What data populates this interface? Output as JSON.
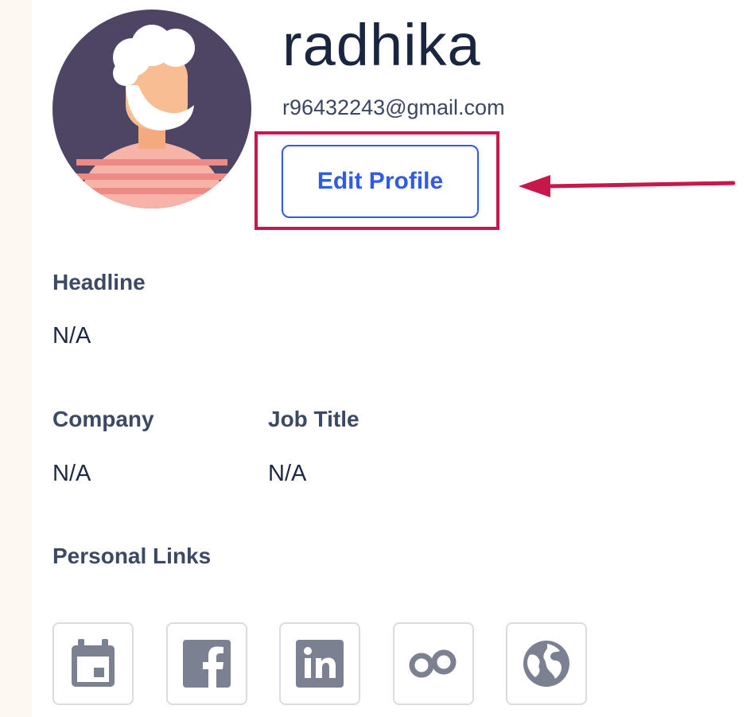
{
  "profile": {
    "name": "radhika",
    "email": "r96432243@gmail.com",
    "edit_button_label": "Edit Profile"
  },
  "fields": {
    "headline_label": "Headline",
    "headline_value": "N/A",
    "company_label": "Company",
    "company_value": "N/A",
    "job_title_label": "Job Title",
    "job_title_value": "N/A",
    "personal_links_label": "Personal Links"
  },
  "personal_links": [
    {
      "icon": "calendar-icon"
    },
    {
      "icon": "facebook-icon"
    },
    {
      "icon": "linkedin-icon"
    },
    {
      "icon": "infinity-link-icon"
    },
    {
      "icon": "globe-icon"
    }
  ],
  "colors": {
    "accent_blue": "#2f5bea",
    "annotation_red": "#c8174a",
    "icon_gray": "#7b8191",
    "avatar_bg": "#4e4564"
  }
}
